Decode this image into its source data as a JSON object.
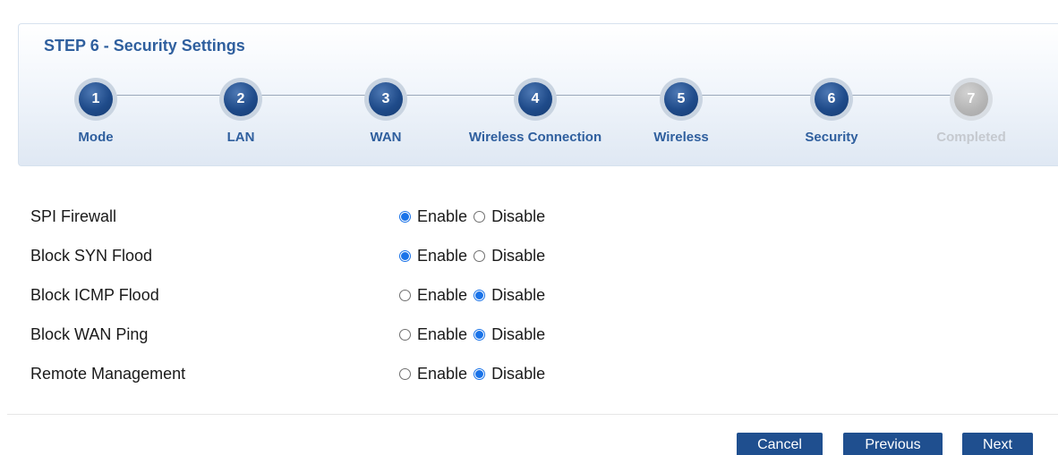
{
  "wizard": {
    "title": "STEP 6 - Security Settings",
    "steps": [
      {
        "number": "1",
        "label": "Mode"
      },
      {
        "number": "2",
        "label": "LAN"
      },
      {
        "number": "3",
        "label": "WAN"
      },
      {
        "number": "4",
        "label": "Wireless Connection"
      },
      {
        "number": "5",
        "label": "Wireless"
      },
      {
        "number": "6",
        "label": "Security"
      },
      {
        "number": "7",
        "label": "Completed"
      }
    ],
    "current_step": 6
  },
  "settings": {
    "enable_label": "Enable",
    "disable_label": "Disable",
    "rows": [
      {
        "label": "SPI Firewall",
        "value": "Enable"
      },
      {
        "label": "Block SYN Flood",
        "value": "Enable"
      },
      {
        "label": "Block ICMP Flood",
        "value": "Disable"
      },
      {
        "label": "Block WAN Ping",
        "value": "Disable"
      },
      {
        "label": "Remote Management",
        "value": "Disable"
      }
    ]
  },
  "buttons": {
    "cancel": "Cancel",
    "previous": "Previous",
    "next": "Next"
  },
  "colors": {
    "accent": "#2f5f9e",
    "step_circle": "#1f4b8a",
    "button": "#1f4f8f",
    "radio_checked": "#1a73e8",
    "step_disabled": "#c5c9cf"
  }
}
